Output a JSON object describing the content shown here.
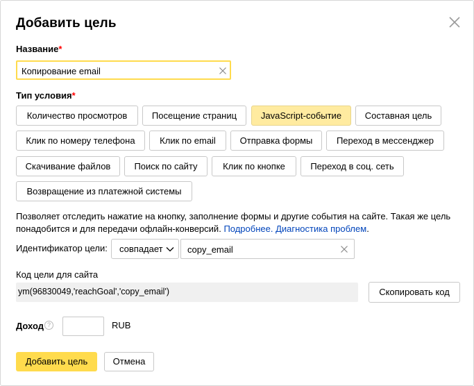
{
  "dialog": {
    "title": "Добавить цель",
    "close_icon": "close-icon"
  },
  "name_field": {
    "label": "Название",
    "required_mark": "*",
    "value": "Копирование email",
    "clear_icon": "clear-icon"
  },
  "condition": {
    "label": "Тип условия",
    "required_mark": "*",
    "types": [
      {
        "label": "Количество просмотров",
        "active": false
      },
      {
        "label": "Посещение страниц",
        "active": false
      },
      {
        "label": "JavaScript-событие",
        "active": true
      },
      {
        "label": "Составная цель",
        "active": false
      },
      {
        "label": "Клик по номеру телефона",
        "active": false
      },
      {
        "label": "Клик по email",
        "active": false
      },
      {
        "label": "Отправка формы",
        "active": false
      },
      {
        "label": "Переход в мессенджер",
        "active": false
      },
      {
        "label": "Скачивание файлов",
        "active": false
      },
      {
        "label": "Поиск по сайту",
        "active": false
      },
      {
        "label": "Клик по кнопке",
        "active": false
      },
      {
        "label": "Переход в соц. сеть",
        "active": false
      },
      {
        "label": "Возвращение из платежной системы",
        "active": false
      }
    ]
  },
  "description": {
    "text_line1": "Позволяет отследить нажатие на кнопку, заполнение формы и другие события на сайте. Такая же цель",
    "text_line2": "понадобится и для передачи офлайн-конверсий.",
    "link_more": "Подробнее.",
    "link_diag": "Диагностика проблем",
    "end": "."
  },
  "identifier": {
    "label": "Идентификатор цели:",
    "match_selected": "совпадает",
    "value": "copy_email"
  },
  "code": {
    "label": "Код цели для сайта",
    "snippet": "ym(96830049,'reachGoal','copy_email')",
    "copy_button": "Скопировать код"
  },
  "income": {
    "label": "Доход",
    "help_icon": "?",
    "value": "",
    "currency": "RUB"
  },
  "footer": {
    "submit_label": "Добавить цель",
    "cancel_label": "Отмена"
  },
  "colors": {
    "accent": "#ffdb4d",
    "active_chip": "#ffeba0",
    "link": "#0044bb",
    "required": "#ff0000"
  }
}
